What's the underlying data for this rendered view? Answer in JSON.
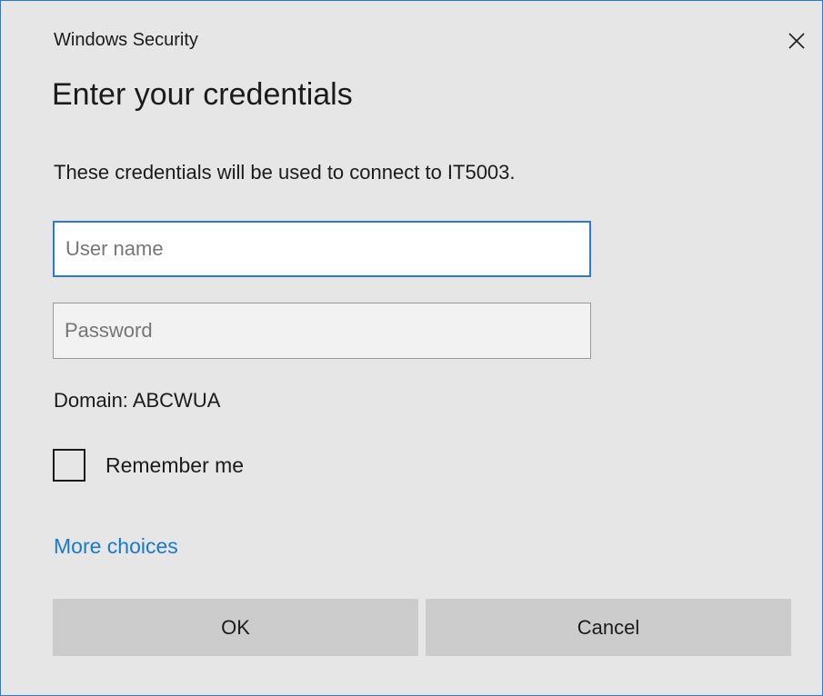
{
  "window": {
    "title": "Windows Security",
    "close_icon": "close-icon"
  },
  "dialog": {
    "heading": "Enter your credentials",
    "description": "These credentials will be used to connect to IT5003.",
    "username": {
      "value": "",
      "placeholder": "User name"
    },
    "password": {
      "value": "",
      "placeholder": "Password"
    },
    "domain_text": "Domain: ABCWUA",
    "remember": {
      "label": "Remember me",
      "checked": false
    },
    "more_choices": "More choices",
    "ok_label": "OK",
    "cancel_label": "Cancel"
  },
  "colors": {
    "accent": "#2b79d0",
    "link": "#1979ca",
    "background": "#e6e6e6",
    "button": "#cccccc"
  }
}
